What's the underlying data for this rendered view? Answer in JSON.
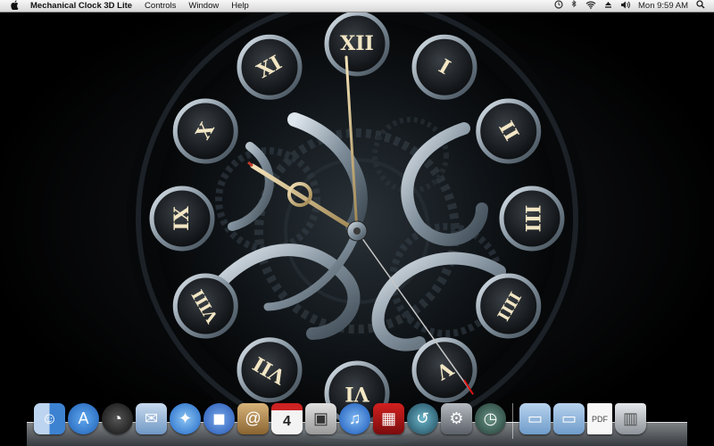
{
  "menubar": {
    "apple_label": "",
    "app_name": "Mechanical Clock 3D Lite",
    "menus": [
      "Controls",
      "Window",
      "Help"
    ],
    "time": "Mon 9:59 AM"
  },
  "clock": {
    "numerals": [
      "XII",
      "I",
      "II",
      "III",
      "IIII",
      "V",
      "VI",
      "VII",
      "VIII",
      "IX",
      "X",
      "XI"
    ],
    "time_shown": "9:59",
    "colors": {
      "metal": "#c8d2dc",
      "numeral": "#f2e6c4",
      "ring": "#1a1f24"
    }
  },
  "dock": {
    "apps": [
      {
        "name": "finder-icon",
        "color": "#4a90d9"
      },
      {
        "name": "app-store-icon",
        "color": "#2e7fd4"
      },
      {
        "name": "dashboard-icon",
        "color": "#333333"
      },
      {
        "name": "mail-icon",
        "color": "#7fa6cf"
      },
      {
        "name": "safari-icon",
        "color": "#3b8ad8"
      },
      {
        "name": "facetime-icon",
        "color": "#3a6fc9"
      },
      {
        "name": "address-book-icon",
        "color": "#b48a55"
      },
      {
        "name": "ical-icon",
        "color": "#eeeeee"
      },
      {
        "name": "preview-icon",
        "color": "#c9c9c9"
      },
      {
        "name": "itunes-icon",
        "color": "#2a6fd6"
      },
      {
        "name": "photo-booth-icon",
        "color": "#b51a1a"
      },
      {
        "name": "time-machine-icon",
        "color": "#2d5a73"
      },
      {
        "name": "system-preferences-icon",
        "color": "#8a8f96"
      },
      {
        "name": "mechanical-clock-icon",
        "color": "#3d6b5e"
      }
    ],
    "folders": [
      {
        "name": "applications-folder-icon",
        "color": "#8fb6de"
      },
      {
        "name": "documents-folder-icon",
        "color": "#8fb6de"
      },
      {
        "name": "pdf-document-icon",
        "color": "#f4f4f4"
      },
      {
        "name": "trash-icon",
        "color": "#b9bec4"
      }
    ],
    "calendar_day": "4"
  }
}
